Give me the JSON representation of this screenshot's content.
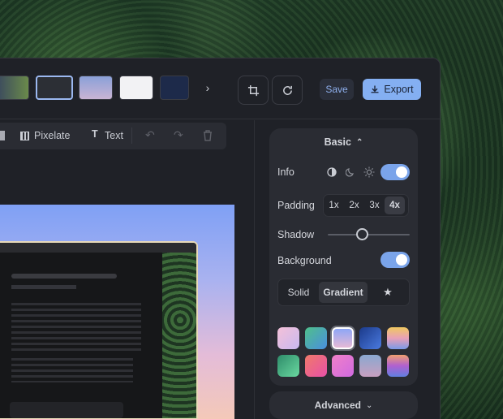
{
  "toolbar": {
    "pixelate": "Pixelate",
    "text": "Text"
  },
  "header": {
    "save": "Save",
    "export": "Export"
  },
  "panel": {
    "basic": "Basic",
    "info": "Info",
    "padding": "Padding",
    "padding_options": [
      "1x",
      "2x",
      "3x",
      "4x"
    ],
    "padding_selected": "4x",
    "shadow": "Shadow",
    "shadow_level": 0.4,
    "background": "Background",
    "bg_tabs": [
      "Solid",
      "Gradient"
    ],
    "bg_selected": "Gradient",
    "advanced": "Advanced",
    "info_on": true,
    "background_on": true
  },
  "colors": {
    "accent": "#84aff2",
    "panel": "#2a2c33",
    "window": "#1f2127"
  }
}
